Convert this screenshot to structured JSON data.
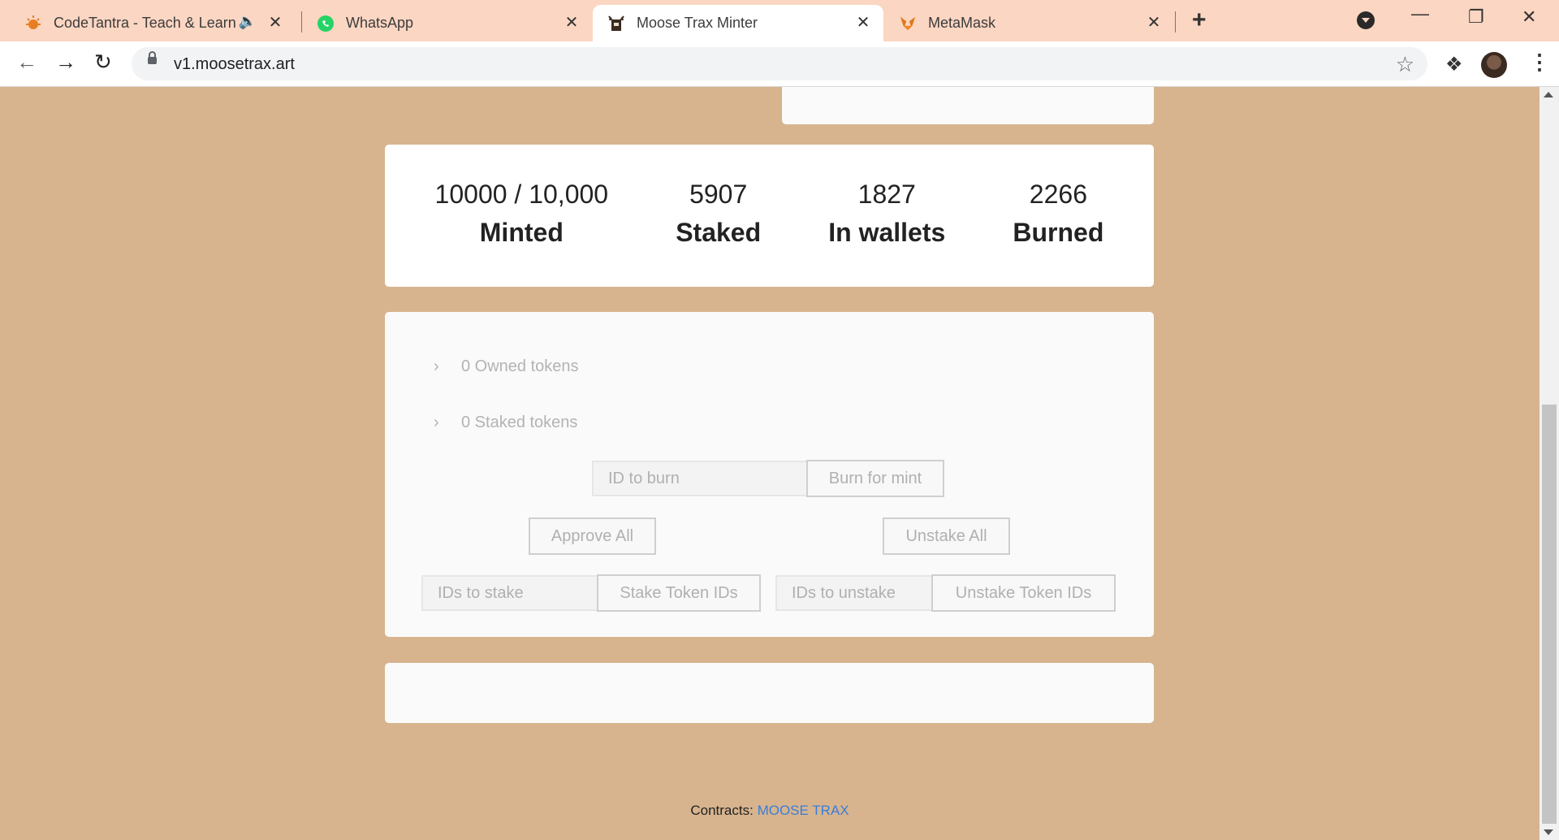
{
  "browser": {
    "tabs": [
      {
        "title": "CodeTantra - Teach & Learn /",
        "icon": "sun-icon"
      },
      {
        "title": "WhatsApp",
        "icon": "whatsapp-icon"
      },
      {
        "title": "Moose Trax Minter",
        "icon": "moose-icon"
      },
      {
        "title": "MetaMask",
        "icon": "fox-icon"
      }
    ],
    "active_tab": 2,
    "new_tab_label": "+",
    "url": "v1.moosetrax.art"
  },
  "stats": [
    {
      "value": "10000 / 10,000",
      "label": "Minted"
    },
    {
      "value": "5907",
      "label": "Staked"
    },
    {
      "value": "1827",
      "label": "In wallets"
    },
    {
      "value": "2266",
      "label": "Burned"
    }
  ],
  "tokens": {
    "owned_label": "0 Owned tokens",
    "staked_label": "0 Staked tokens"
  },
  "burn": {
    "placeholder": "ID to burn",
    "button": "Burn for mint"
  },
  "approve_all": "Approve All",
  "unstake_all": "Unstake All",
  "stake": {
    "placeholder": "IDs to stake",
    "button": "Stake Token IDs"
  },
  "unstake": {
    "placeholder": "IDs to unstake",
    "button": "Unstake Token IDs"
  },
  "footer": {
    "prefix": "Contracts:",
    "link": "MOOSE TRAX"
  }
}
